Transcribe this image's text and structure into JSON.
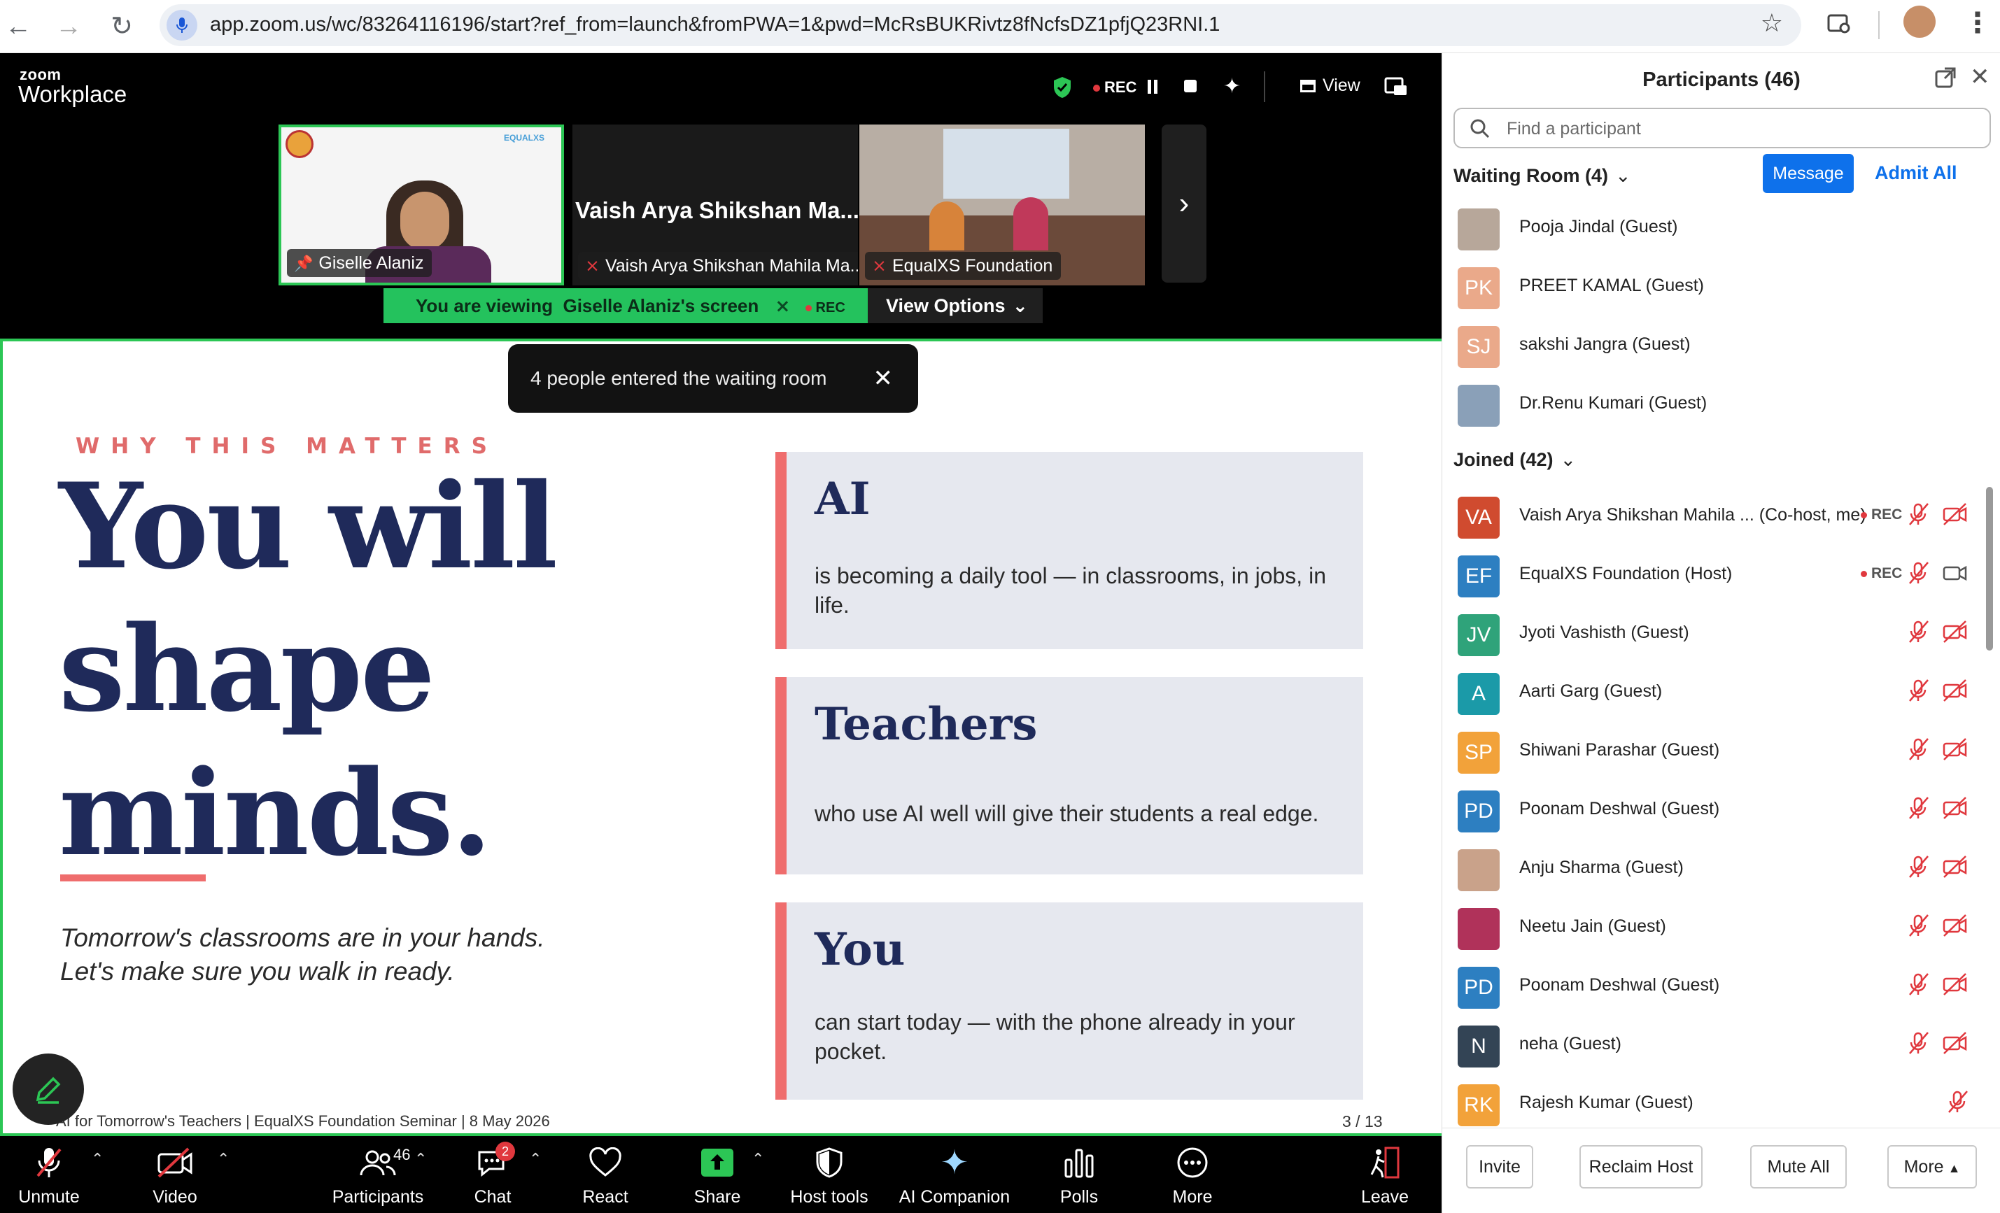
{
  "browser": {
    "url": "app.zoom.us/wc/83264116196/start?ref_from=launch&fromPWA=1&pwd=McRsBUKRivtz8fNcfsDZ1pfjQ23RNI.1"
  },
  "zoom_header": {
    "logo_top": "zoom",
    "logo_bottom": "Workplace",
    "rec_label": "REC",
    "view_label": "View"
  },
  "thumbnails": [
    {
      "name": "Giselle Alaniz",
      "pinned": true
    },
    {
      "name": "Vaish Arya Shikshan Mahila Ma...",
      "display_title": "Vaish Arya Shikshan Ma...",
      "muted": true
    },
    {
      "name": "EqualXS Foundation",
      "muted": true
    }
  ],
  "viewing_bar": {
    "prefix": "You are viewing",
    "who": "Giselle Alaniz's screen",
    "rec": "REC",
    "options": "View Options"
  },
  "toast": {
    "text": "4 people entered the waiting room"
  },
  "slide": {
    "kicker": "WHY THIS MATTERS",
    "line1": "You will",
    "line2": "shape",
    "line3": "minds.",
    "sub1": "Tomorrow's classrooms are in your hands.",
    "sub2": "Let's make sure you walk in ready.",
    "cards": [
      {
        "title": "AI",
        "text": "is becoming a daily tool — in classrooms, in jobs, in life."
      },
      {
        "title": "Teachers",
        "text": "who use AI well will give their students a real edge."
      },
      {
        "title": "You",
        "text": "can start today — with the phone already in your pocket."
      }
    ],
    "footer": "AI for Tomorrow's Teachers  |  EqualXS Foundation Seminar  |  8 May 2026",
    "page": "3 / 13"
  },
  "toolbar": {
    "unmute": "Unmute",
    "video": "Video",
    "participants": "Participants",
    "participants_count": "46",
    "chat": "Chat",
    "chat_badge": "2",
    "react": "React",
    "share": "Share",
    "host_tools": "Host tools",
    "ai_companion": "AI Companion",
    "polls": "Polls",
    "more": "More",
    "leave": "Leave"
  },
  "panel": {
    "title": "Participants (46)",
    "search_placeholder": "Find a participant",
    "waiting_header": "Waiting Room (4)",
    "message_btn": "Message",
    "admit_all": "Admit All",
    "waiting": [
      {
        "name": "Pooja Jindal (Guest)",
        "initials": "",
        "color": "#b7a79a",
        "photo": true
      },
      {
        "name": "PREET KAMAL (Guest)",
        "initials": "PK",
        "color": "#eaa98a"
      },
      {
        "name": "sakshi Jangra (Guest)",
        "initials": "SJ",
        "color": "#eaa98a"
      },
      {
        "name": "Dr.Renu Kumari (Guest)",
        "initials": "",
        "color": "#8aa0b8",
        "photo": true
      }
    ],
    "joined_header": "Joined (42)",
    "joined": [
      {
        "name": "Vaish Arya Shikshan Mahila ... (Co-host, me)",
        "initials": "VA",
        "color": "#d04b2f",
        "rec": "REC",
        "cam": "off"
      },
      {
        "name": "EqualXS Foundation (Host)",
        "initials": "EF",
        "color": "#2d7fc1",
        "rec": "REC",
        "cam": "on"
      },
      {
        "name": "Jyoti Vashisth (Guest)",
        "initials": "JV",
        "color": "#2fa37a",
        "cam": "off"
      },
      {
        "name": "Aarti Garg (Guest)",
        "initials": "A",
        "color": "#1b9aa8",
        "cam": "off"
      },
      {
        "name": "Shiwani Parashar (Guest)",
        "initials": "SP",
        "color": "#f2a23a",
        "cam": "off"
      },
      {
        "name": "Poonam Deshwal (Guest)",
        "initials": "PD",
        "color": "#2d7fc1",
        "cam": "off"
      },
      {
        "name": "Anju Sharma (Guest)",
        "initials": "",
        "color": "#c9a28a",
        "photo": true,
        "cam": "off"
      },
      {
        "name": "Neetu Jain (Guest)",
        "initials": "",
        "color": "#b0325a",
        "photo": true,
        "cam": "off"
      },
      {
        "name": "Poonam Deshwal (Guest)",
        "initials": "PD",
        "color": "#2d7fc1",
        "cam": "off"
      },
      {
        "name": "neha (Guest)",
        "initials": "N",
        "color": "#334455",
        "cam": "off"
      },
      {
        "name": "Rajesh Kumar (Guest)",
        "initials": "RK",
        "color": "#f2a23a",
        "cam": "none"
      }
    ],
    "footer_buttons": [
      "Invite",
      "Reclaim Host",
      "Mute All",
      "More"
    ]
  },
  "colors": {
    "accent_green": "#24c25d",
    "zoom_blue": "#0e71eb",
    "slide_navy": "#1f2a5a",
    "slide_coral": "#ef6d6d"
  }
}
